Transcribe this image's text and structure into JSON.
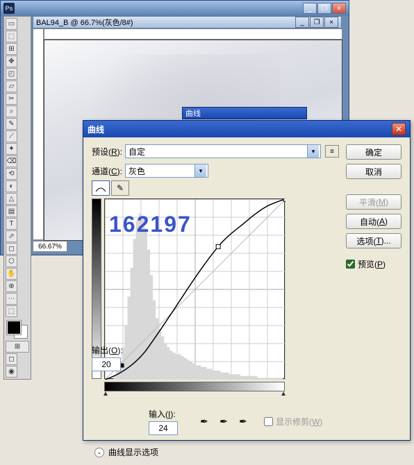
{
  "photoshop": {
    "app_icon": "Ps",
    "doc_title": "BAL94_B @ 66.7%(灰色/8#)",
    "zoom": "66.67%",
    "tools": [
      "▭",
      "⬚",
      "⊞",
      "✥",
      "◰",
      "▱",
      "✂",
      "⌕",
      "✎",
      "⟋",
      "✦",
      "⌫",
      "⟲",
      "◐",
      "△",
      "▤",
      "T",
      "⬀",
      "◻",
      "⬡",
      "✋",
      "⊕",
      "⋯",
      "⬚"
    ]
  },
  "small_hdr": "曲线",
  "curves": {
    "title": "曲线",
    "preset_label": "预设(",
    "preset_key": "R",
    "preset_after": "):",
    "preset_value": "自定",
    "channel_label": "通道(",
    "channel_key": "C",
    "channel_after": "):",
    "channel_value": "灰色",
    "output_label": "输出(",
    "output_key": "O",
    "output_after": "):",
    "output_value": "20",
    "input_label": "输入(",
    "input_key": "I",
    "input_after": "):",
    "input_value": "24",
    "clip_label": "显示修剪(",
    "clip_key": "W",
    "clip_after": ")",
    "disclosure": "曲线显示选项",
    "watermark": "162197",
    "buttons": {
      "ok": "确定",
      "cancel": "取消",
      "smooth_label": "平滑(",
      "smooth_key": "M",
      "smooth_after": ")",
      "auto_label": "自动(",
      "auto_key": "A",
      "auto_after": ")",
      "options_label": "选项(",
      "options_key": "T",
      "options_after": ")...",
      "preview_label": "预览(",
      "preview_key": "P",
      "preview_after": ")"
    }
  },
  "chart_data": {
    "type": "line",
    "title": "曲线",
    "xlabel": "输入",
    "ylabel": "输出",
    "xlim": [
      0,
      255
    ],
    "ylim": [
      0,
      255
    ],
    "series": [
      {
        "name": "baseline",
        "x": [
          0,
          255
        ],
        "y": [
          0,
          255
        ]
      },
      {
        "name": "curve",
        "points": [
          {
            "x": 0,
            "y": 0
          },
          {
            "x": 24,
            "y": 20
          },
          {
            "x": 60,
            "y": 44
          },
          {
            "x": 110,
            "y": 118
          },
          {
            "x": 160,
            "y": 188
          },
          {
            "x": 200,
            "y": 224
          },
          {
            "x": 235,
            "y": 248
          },
          {
            "x": 255,
            "y": 255
          }
        ]
      }
    ],
    "control_points": [
      {
        "x": 24,
        "y": 20,
        "selected": true
      },
      {
        "x": 160,
        "y": 188,
        "selected": false
      },
      {
        "x": 255,
        "y": 255,
        "selected": false
      }
    ],
    "histogram_approx": [
      0,
      0,
      0,
      2,
      5,
      10,
      18,
      30,
      46,
      62,
      78,
      88,
      92,
      90,
      84,
      72,
      58,
      44,
      34,
      28,
      24,
      20,
      18,
      16,
      15,
      14,
      14,
      13,
      12,
      11,
      10,
      9,
      8,
      8,
      7,
      7,
      6,
      6,
      5,
      5,
      5,
      4,
      4,
      4,
      3,
      3,
      3,
      3,
      2,
      2,
      2,
      2,
      2,
      2,
      1,
      1,
      1,
      1,
      1,
      1,
      1,
      1,
      1,
      0
    ]
  }
}
